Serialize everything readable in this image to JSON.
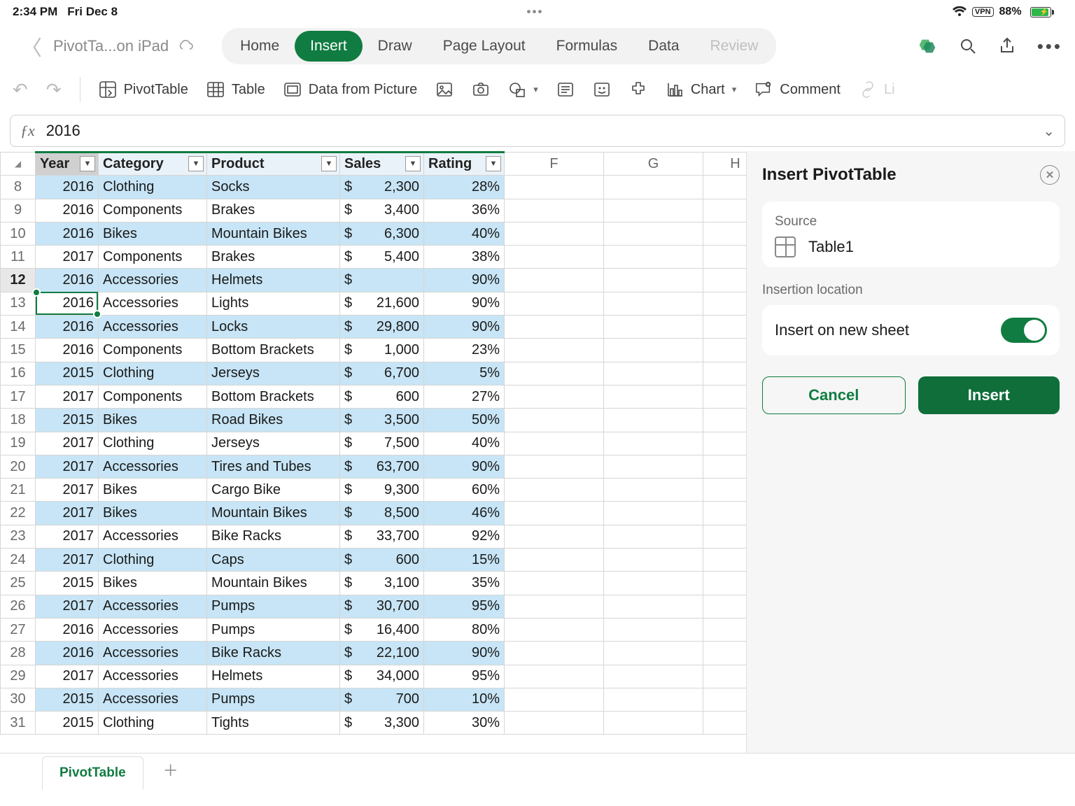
{
  "status": {
    "time": "2:34 PM",
    "date": "Fri Dec 8",
    "battery": "88%",
    "vpn": "VPN"
  },
  "title": {
    "docname": "PivotTa...on iPad"
  },
  "tabs": [
    "Home",
    "Insert",
    "Draw",
    "Page Layout",
    "Formulas",
    "Data",
    "Review"
  ],
  "active_tab": "Insert",
  "ribbon": {
    "pivot": "PivotTable",
    "table": "Table",
    "datapic": "Data from Picture",
    "chart": "Chart",
    "comment": "Comment",
    "link": "Li"
  },
  "formula": {
    "value": "2016"
  },
  "headers": [
    "Year",
    "Category",
    "Product",
    "Sales",
    "Rating"
  ],
  "col_letters": [
    "F",
    "G",
    "H"
  ],
  "rows": [
    {
      "n": 8,
      "year": "2016",
      "cat": "Clothing",
      "prod": "Socks",
      "sales": "2,300",
      "rating": "28%",
      "alt": false
    },
    {
      "n": 9,
      "year": "2016",
      "cat": "Components",
      "prod": "Brakes",
      "sales": "3,400",
      "rating": "36%",
      "alt": true
    },
    {
      "n": 10,
      "year": "2016",
      "cat": "Bikes",
      "prod": "Mountain Bikes",
      "sales": "6,300",
      "rating": "40%",
      "alt": false
    },
    {
      "n": 11,
      "year": "2017",
      "cat": "Components",
      "prod": "Brakes",
      "sales": "5,400",
      "rating": "38%",
      "alt": true
    },
    {
      "n": 12,
      "year": "2016",
      "cat": "Accessories",
      "prod": "Helmets",
      "sales": "",
      "rating": "90%",
      "alt": false
    },
    {
      "n": 13,
      "year": "2016",
      "cat": "Accessories",
      "prod": "Lights",
      "sales": "21,600",
      "rating": "90%",
      "alt": true
    },
    {
      "n": 14,
      "year": "2016",
      "cat": "Accessories",
      "prod": "Locks",
      "sales": "29,800",
      "rating": "90%",
      "alt": false
    },
    {
      "n": 15,
      "year": "2016",
      "cat": "Components",
      "prod": "Bottom Brackets",
      "sales": "1,000",
      "rating": "23%",
      "alt": true
    },
    {
      "n": 16,
      "year": "2015",
      "cat": "Clothing",
      "prod": "Jerseys",
      "sales": "6,700",
      "rating": "5%",
      "alt": false
    },
    {
      "n": 17,
      "year": "2017",
      "cat": "Components",
      "prod": "Bottom Brackets",
      "sales": "600",
      "rating": "27%",
      "alt": true
    },
    {
      "n": 18,
      "year": "2015",
      "cat": "Bikes",
      "prod": "Road Bikes",
      "sales": "3,500",
      "rating": "50%",
      "alt": false
    },
    {
      "n": 19,
      "year": "2017",
      "cat": "Clothing",
      "prod": "Jerseys",
      "sales": "7,500",
      "rating": "40%",
      "alt": true
    },
    {
      "n": 20,
      "year": "2017",
      "cat": "Accessories",
      "prod": "Tires and Tubes",
      "sales": "63,700",
      "rating": "90%",
      "alt": false
    },
    {
      "n": 21,
      "year": "2017",
      "cat": "Bikes",
      "prod": "Cargo Bike",
      "sales": "9,300",
      "rating": "60%",
      "alt": true
    },
    {
      "n": 22,
      "year": "2017",
      "cat": "Bikes",
      "prod": "Mountain Bikes",
      "sales": "8,500",
      "rating": "46%",
      "alt": false
    },
    {
      "n": 23,
      "year": "2017",
      "cat": "Accessories",
      "prod": "Bike Racks",
      "sales": "33,700",
      "rating": "92%",
      "alt": true
    },
    {
      "n": 24,
      "year": "2017",
      "cat": "Clothing",
      "prod": "Caps",
      "sales": "600",
      "rating": "15%",
      "alt": false
    },
    {
      "n": 25,
      "year": "2015",
      "cat": "Bikes",
      "prod": "Mountain Bikes",
      "sales": "3,100",
      "rating": "35%",
      "alt": true
    },
    {
      "n": 26,
      "year": "2017",
      "cat": "Accessories",
      "prod": "Pumps",
      "sales": "30,700",
      "rating": "95%",
      "alt": false
    },
    {
      "n": 27,
      "year": "2016",
      "cat": "Accessories",
      "prod": "Pumps",
      "sales": "16,400",
      "rating": "80%",
      "alt": true
    },
    {
      "n": 28,
      "year": "2016",
      "cat": "Accessories",
      "prod": "Bike Racks",
      "sales": "22,100",
      "rating": "90%",
      "alt": false
    },
    {
      "n": 29,
      "year": "2017",
      "cat": "Accessories",
      "prod": "Helmets",
      "sales": "34,000",
      "rating": "95%",
      "alt": true
    },
    {
      "n": 30,
      "year": "2015",
      "cat": "Accessories",
      "prod": "Pumps",
      "sales": "700",
      "rating": "10%",
      "alt": false
    },
    {
      "n": 31,
      "year": "2015",
      "cat": "Clothing",
      "prod": "Tights",
      "sales": "3,300",
      "rating": "30%",
      "alt": true
    }
  ],
  "selected_row": 12,
  "panel": {
    "title": "Insert PivotTable",
    "source_label": "Source",
    "source_name": "Table1",
    "insertion_label": "Insertion location",
    "toggle_label": "Insert on new sheet",
    "cancel": "Cancel",
    "insert": "Insert"
  },
  "sheet": {
    "name": "PivotTable"
  }
}
